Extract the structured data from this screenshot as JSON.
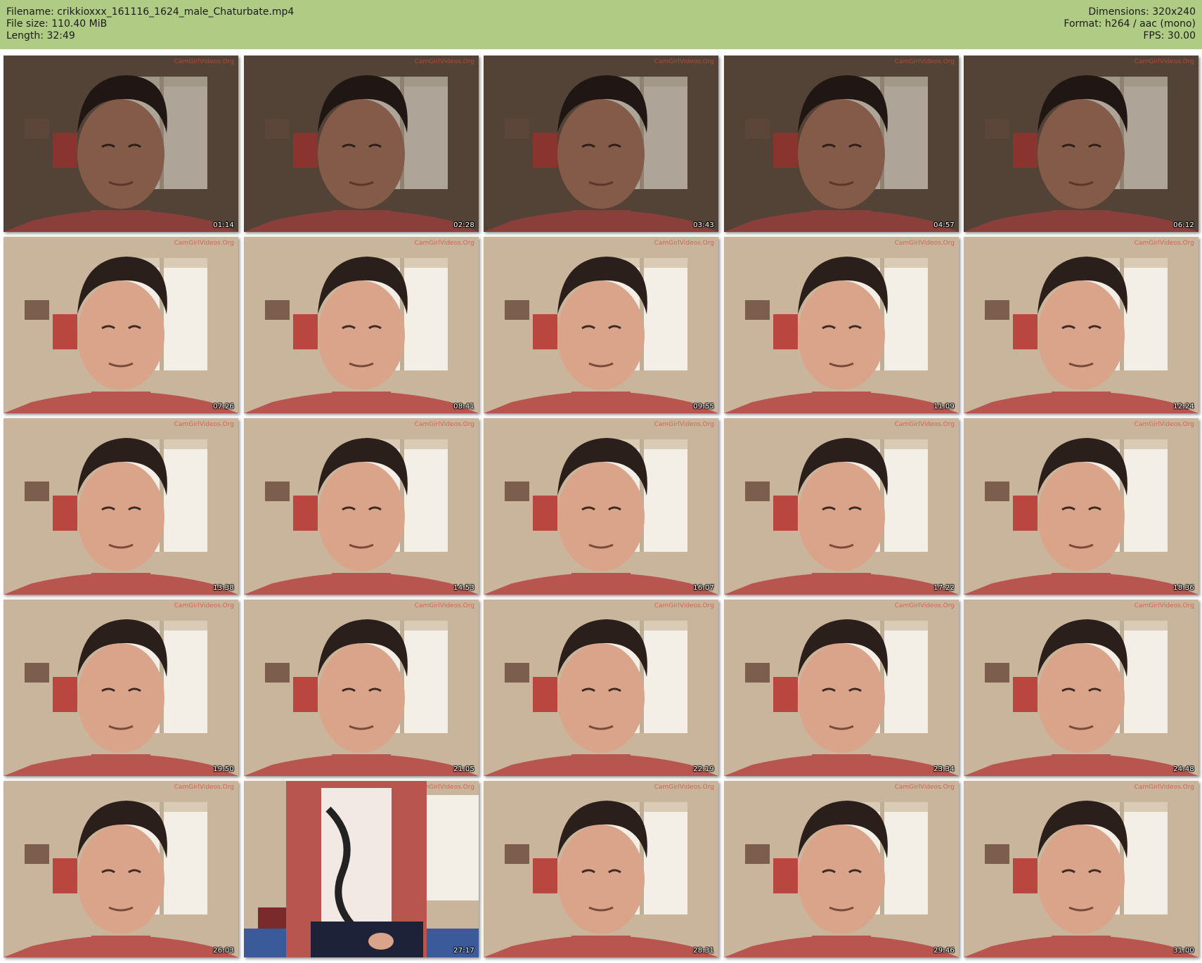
{
  "header": {
    "filename_line": "Filename: crikkioxxx_161116_1624_male_Chaturbate.mp4",
    "filesize_line": "File size: 110.40 MiB",
    "length_line": "Length: 32:49",
    "dimensions_line": "Dimensions: 320x240",
    "format_line": "Format: h264 / aac (mono)",
    "fps_line": "FPS: 30.00"
  },
  "colors": {
    "header_bg": "#b0cc84",
    "shirt": "#b9554f",
    "hair": "#2b1f1b",
    "skin": "#d9a48a",
    "window": "#f4efe6",
    "wall": "#c9b59c"
  },
  "watermark": "CamGirlVideos.Org",
  "thumbnails": [
    {
      "time": "01:14",
      "variant": "dark"
    },
    {
      "time": "02:28",
      "variant": "dark"
    },
    {
      "time": "03:43",
      "variant": "dark"
    },
    {
      "time": "04:57",
      "variant": "dark"
    },
    {
      "time": "06:12",
      "variant": "dark"
    },
    {
      "time": "07:26",
      "variant": "bright"
    },
    {
      "time": "08:41",
      "variant": "bright"
    },
    {
      "time": "09:55",
      "variant": "bright"
    },
    {
      "time": "11:09",
      "variant": "bright"
    },
    {
      "time": "12:24",
      "variant": "bright"
    },
    {
      "time": "13:38",
      "variant": "bright"
    },
    {
      "time": "14:53",
      "variant": "bright"
    },
    {
      "time": "16:07",
      "variant": "bright"
    },
    {
      "time": "17:22",
      "variant": "bright"
    },
    {
      "time": "18:36",
      "variant": "bright"
    },
    {
      "time": "19:50",
      "variant": "bright"
    },
    {
      "time": "21:05",
      "variant": "bright"
    },
    {
      "time": "22:19",
      "variant": "bright"
    },
    {
      "time": "23:34",
      "variant": "bright"
    },
    {
      "time": "24:48",
      "variant": "bright"
    },
    {
      "time": "26:03",
      "variant": "bright"
    },
    {
      "time": "27:17",
      "variant": "shirt"
    },
    {
      "time": "28:31",
      "variant": "bright"
    },
    {
      "time": "29:46",
      "variant": "bright"
    },
    {
      "time": "31:00",
      "variant": "bright"
    }
  ]
}
